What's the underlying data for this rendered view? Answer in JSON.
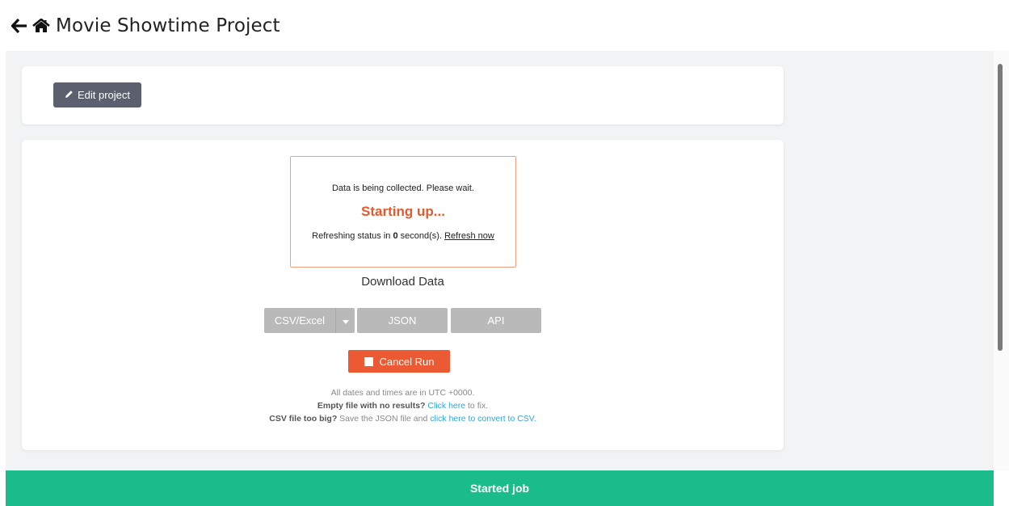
{
  "header": {
    "back_icon": "arrow-left-icon",
    "home_icon": "home-icon",
    "title": "Movie Showtime Project"
  },
  "toolbar": {
    "edit_icon": "pencil-icon",
    "edit_label": "Edit project"
  },
  "status": {
    "message": "Data is being collected. Please wait.",
    "state": "Starting up...",
    "refresh_prefix": "Refreshing status in",
    "refresh_seconds": "0",
    "refresh_suffix": "second(s).",
    "refresh_link": "Refresh now",
    "state_color": "#e9572b"
  },
  "download": {
    "title": "Download Data",
    "csv_label": "CSV/Excel",
    "csv_caret_icon": "caret-down-icon",
    "json_label": "JSON",
    "api_label": "API"
  },
  "cancel": {
    "icon": "stop-icon",
    "label": "Cancel Run",
    "color": "#ec5a34"
  },
  "notes": {
    "line1": "All dates and times are in UTC +0000.",
    "line2_bold": "Empty file with no results?",
    "line2_link": "Click here",
    "line2_suffix": "to fix.",
    "line3_bold": "CSV file too big?",
    "line3_text": "Save the JSON file and",
    "line3_link": "click here to convert to CSV."
  },
  "footer": {
    "message": "Started job",
    "color": "#1abc8c"
  }
}
